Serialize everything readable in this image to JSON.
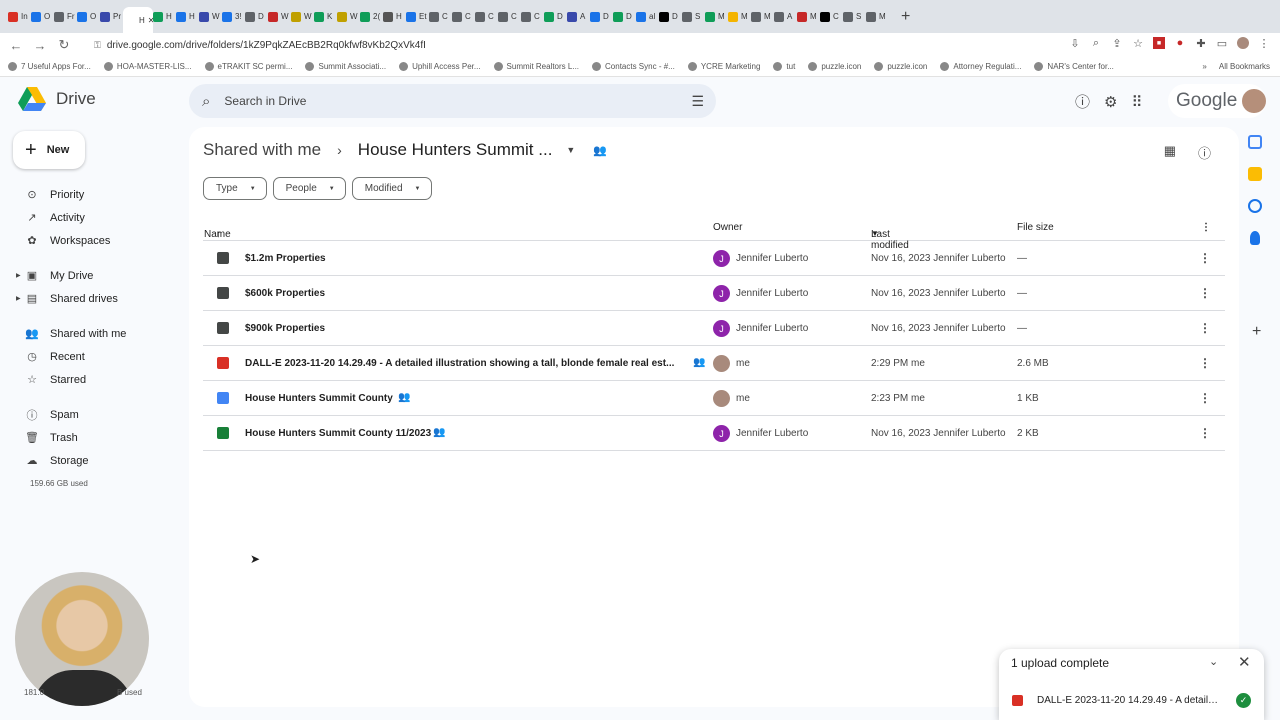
{
  "browser": {
    "tabs": [
      {
        "label": "In",
        "color": "#d93025"
      },
      {
        "label": "O",
        "color": "#1a73e8"
      },
      {
        "label": "Fr",
        "color": "#5f6368"
      },
      {
        "label": "O",
        "color": "#1a73e8"
      },
      {
        "label": "Pr",
        "color": "#3949ab"
      },
      {
        "label": "H",
        "color": "#ffffff"
      },
      {
        "label": "H",
        "color": "#0f9d58"
      },
      {
        "label": "H",
        "color": "#1a73e8"
      },
      {
        "label": "W",
        "color": "#3949ab"
      },
      {
        "label": "3!",
        "color": "#1a73e8"
      },
      {
        "label": "D",
        "color": "#5f6368"
      },
      {
        "label": "W",
        "color": "#c62828"
      },
      {
        "label": "W",
        "color": "#c0a000"
      },
      {
        "label": "K",
        "color": "#0f9d58"
      },
      {
        "label": "W",
        "color": "#c0a000"
      },
      {
        "label": "2(",
        "color": "#0f9d58"
      },
      {
        "label": "H",
        "color": "#555555"
      },
      {
        "label": "Et",
        "color": "#1a73e8"
      },
      {
        "label": "C",
        "color": "#5f6368"
      },
      {
        "label": "C",
        "color": "#5f6368"
      },
      {
        "label": "C",
        "color": "#5f6368"
      },
      {
        "label": "C",
        "color": "#5f6368"
      },
      {
        "label": "C",
        "color": "#5f6368"
      },
      {
        "label": "D",
        "color": "#0f9d58"
      },
      {
        "label": "A",
        "color": "#3949ab"
      },
      {
        "label": "D",
        "color": "#1a73e8"
      },
      {
        "label": "D",
        "color": "#0f9d58"
      },
      {
        "label": "al",
        "color": "#1a73e8"
      },
      {
        "label": "D",
        "color": "#000000"
      },
      {
        "label": "S",
        "color": "#5f6368"
      },
      {
        "label": "M",
        "color": "#0f9d58"
      },
      {
        "label": "M",
        "color": "#f4b400"
      },
      {
        "label": "M",
        "color": "#5f6368"
      },
      {
        "label": "A",
        "color": "#5f6368"
      },
      {
        "label": "M",
        "color": "#c62828"
      },
      {
        "label": "C",
        "color": "#000000"
      },
      {
        "label": "S",
        "color": "#5f6368"
      },
      {
        "label": "M",
        "color": "#5f6368"
      }
    ],
    "active_tab_label": "H",
    "url": "drive.google.com/drive/folders/1kZ9PqkZAEcBB2Rq0kfwf8vKb2QxVk4fI",
    "bookmarks": [
      "7 Useful Apps For...",
      "HOA-MASTER-LIS...",
      "eTRAKIT SC permi...",
      "Summit Associati...",
      "Uphill Access Per...",
      "Summit Realtors L...",
      "Contacts Sync - #...",
      "YCRE Marketing",
      "tut",
      "puzzle.icon",
      "puzzle.icon",
      "Attorney Regulati...",
      "NAR's Center for..."
    ],
    "all_bookmarks": "All Bookmarks"
  },
  "app": {
    "name": "Drive",
    "brand": "Google"
  },
  "search": {
    "placeholder": "Search in Drive"
  },
  "new_button": "New",
  "sidebar": {
    "items": [
      {
        "label": "Priority",
        "icon": "check-circle-icon"
      },
      {
        "label": "Activity",
        "icon": "activity-icon"
      },
      {
        "label": "Workspaces",
        "icon": "workspaces-icon"
      },
      {
        "label": "My Drive",
        "icon": "my-drive-icon"
      },
      {
        "label": "Shared drives",
        "icon": "shared-drives-icon"
      },
      {
        "label": "Shared with me",
        "icon": "people-icon"
      },
      {
        "label": "Recent",
        "icon": "clock-icon"
      },
      {
        "label": "Starred",
        "icon": "star-icon"
      },
      {
        "label": "Spam",
        "icon": "spam-icon"
      },
      {
        "label": "Trash",
        "icon": "trash-icon"
      },
      {
        "label": "Storage",
        "icon": "cloud-icon"
      }
    ],
    "storage_used": "159.66 GB used"
  },
  "breadcrumb": {
    "root": "Shared with me",
    "current": "House Hunters Summit ..."
  },
  "filters": [
    "Type",
    "People",
    "Modified"
  ],
  "table": {
    "headers": {
      "name": "Name",
      "owner": "Owner",
      "modified": "Last modified",
      "size": "File size"
    },
    "rows": [
      {
        "name": "$1.2m Properties",
        "type": "folder",
        "shared": false,
        "owner": "Jennifer Luberto",
        "owner_initial": "J",
        "modified": "Nov 16, 2023 Jennifer Luberto",
        "size": "—"
      },
      {
        "name": "$600k Properties",
        "type": "folder",
        "shared": false,
        "owner": "Jennifer Luberto",
        "owner_initial": "J",
        "modified": "Nov 16, 2023 Jennifer Luberto",
        "size": "—"
      },
      {
        "name": "$900k Properties",
        "type": "folder",
        "shared": false,
        "owner": "Jennifer Luberto",
        "owner_initial": "J",
        "modified": "Nov 16, 2023 Jennifer Luberto",
        "size": "—"
      },
      {
        "name": "DALL-E 2023-11-20 14.29.49 - A detailed illustration showing a tall, blonde female real est...",
        "type": "image",
        "shared": true,
        "owner": "me",
        "owner_initial": "",
        "modified": "2:29 PM me",
        "size": "2.6 MB"
      },
      {
        "name": "House Hunters Summit County",
        "type": "doc",
        "shared": true,
        "owner": "me",
        "owner_initial": "",
        "modified": "2:23 PM me",
        "size": "1 KB"
      },
      {
        "name": "House Hunters Summit County 11/2023",
        "type": "sheet",
        "shared": true,
        "owner": "Jennifer Luberto",
        "owner_initial": "J",
        "modified": "Nov 16, 2023 Jennifer Luberto",
        "size": "2 KB"
      }
    ]
  },
  "webcam_overlay": {
    "left_text": "181.0",
    "right_text": "B used"
  },
  "upload_panel": {
    "title": "1 upload complete",
    "file": "DALL-E 2023-11-20 14.29.49 - A detailed illustration"
  },
  "colors": {
    "folder": "#444746",
    "image": "#d93025",
    "doc": "#4285f4",
    "sheet": "#188038",
    "owner_avatar": "#8e24aa",
    "me_avatar": "#a88a7c"
  }
}
